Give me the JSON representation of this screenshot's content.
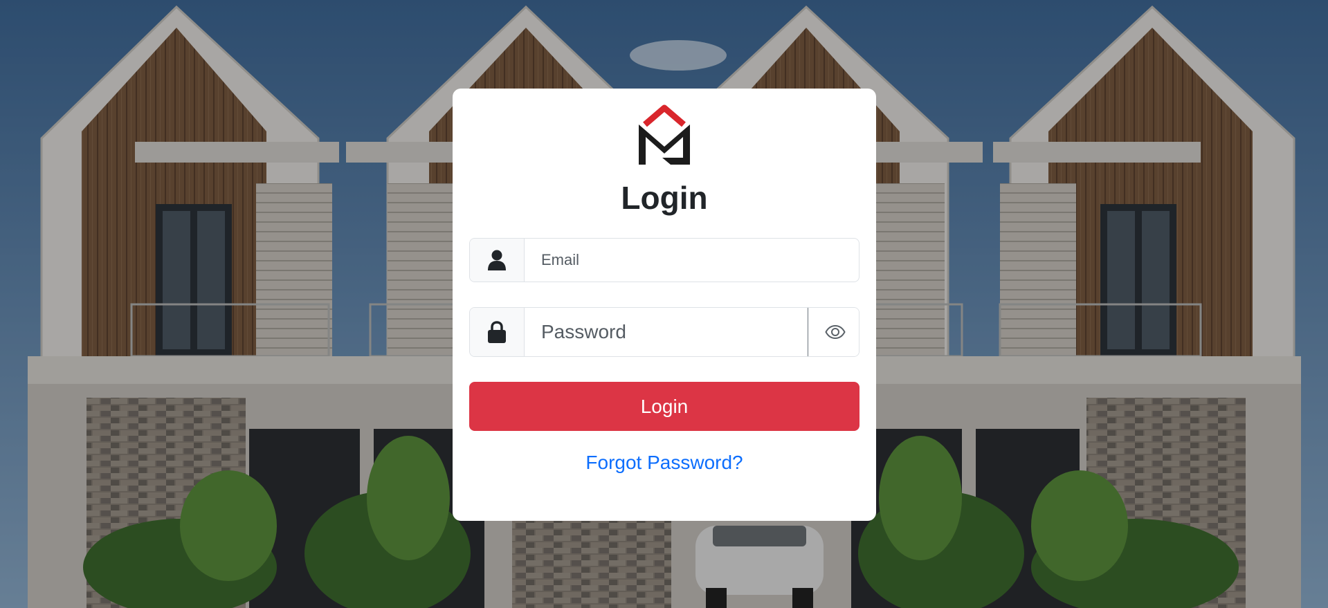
{
  "login": {
    "title": "Login",
    "email": {
      "icon": "user-icon",
      "value": "",
      "placeholder": "Email"
    },
    "password": {
      "icon": "lock-icon",
      "value": "",
      "placeholder": "Password",
      "toggle_icon": "eye-icon"
    },
    "submit_label": "Login",
    "forgot_label": "Forgot Password?"
  },
  "logo": {
    "icon": "house-envelope-logo",
    "accent_color": "#d9262c"
  },
  "colors": {
    "primary_button": "#dc3545",
    "link": "#0d6efd",
    "card_background": "#ffffff"
  },
  "background": {
    "description_icon": "townhouse-photo"
  }
}
